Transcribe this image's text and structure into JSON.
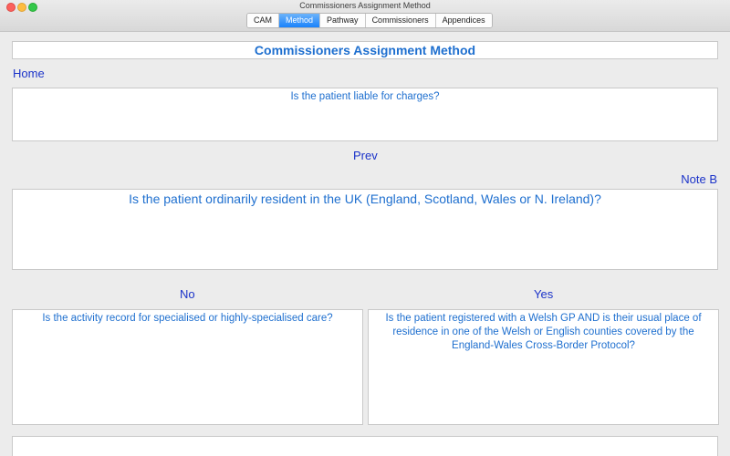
{
  "window": {
    "title": "Commissioners Assignment Method"
  },
  "tabs": [
    {
      "label": "CAM",
      "active": false
    },
    {
      "label": "Method",
      "active": true
    },
    {
      "label": "Pathway",
      "active": false
    },
    {
      "label": "Commissioners",
      "active": false
    },
    {
      "label": "Appendices",
      "active": false
    }
  ],
  "main": {
    "heading": "Commissioners Assignment Method",
    "home_link": "Home",
    "previous_question": "Is the patient liable for charges?",
    "prev_link": "Prev",
    "note_link": "Note B",
    "current_question": "Is the patient ordinarily resident in the UK (England, Scotland, Wales or N. Ireland)?",
    "no_label": "No",
    "yes_label": "Yes",
    "no_question": "Is the activity record for specialised or highly-specialised care?",
    "yes_question": "Is the patient registered with a Welsh GP AND is their usual place of residence in one of the Welsh or English counties covered by the England-Wales Cross-Border Protocol?"
  },
  "colors": {
    "heading_text": "#1e6fcf",
    "link_text": "#1b33c9",
    "active_tab": "#1a82fb"
  }
}
